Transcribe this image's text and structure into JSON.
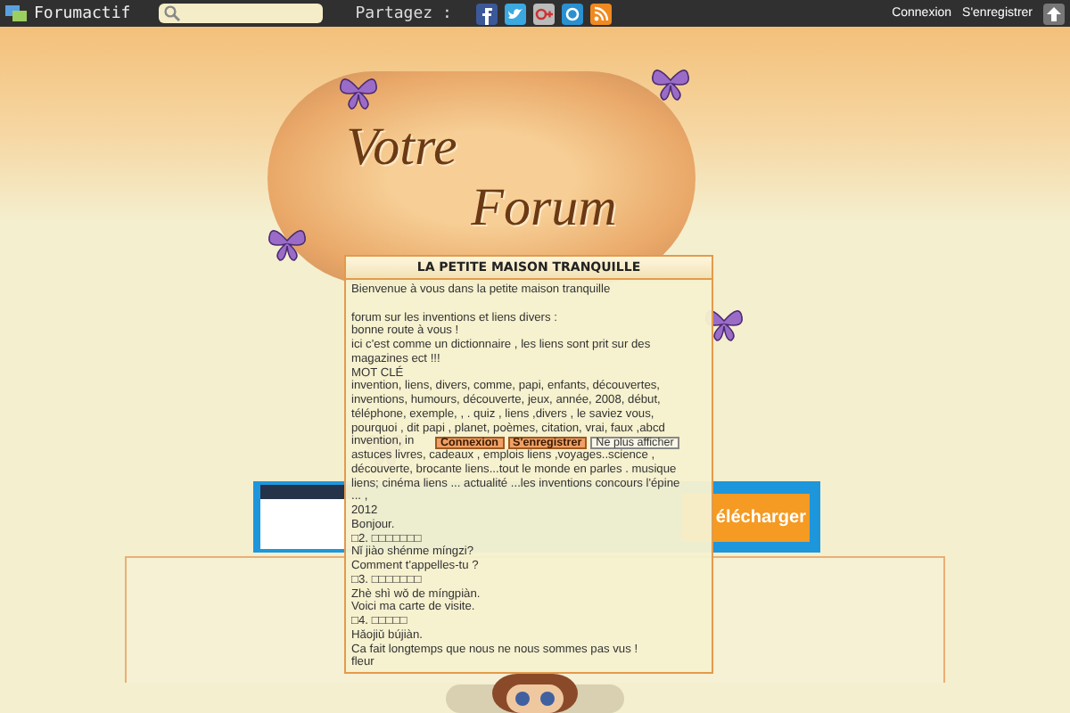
{
  "top_bar": {
    "brand": "Forumactif",
    "share_label": "Partagez :",
    "links": [
      "Connexion",
      "S'enregistrer"
    ]
  },
  "banner": {
    "logo_words": [
      "Votre",
      "Forum"
    ]
  },
  "ad": {
    "button": "élécharger"
  },
  "popup": {
    "title": "LA PETITE MAISON TRANQUILLE",
    "greeting": "Bienvenue à vous dans la petite maison tranquille",
    "lines": [
      "forum sur les inventions et liens divers :",
      "bonne route à vous !",
      "ici c'est comme un dictionnaire , les liens sont prit sur des",
      "magazines ect !!!",
      "MOT CLÉ",
      "invention, liens, divers, comme, papi, enfants, découvertes,",
      "inventions, humours, découverte, jeux, année, 2008, début,",
      "téléphone, exemple, , . quiz , liens ,divers , le saviez vous,",
      "pourquoi , dit papi , planet, poèmes, citation, vrai, faux ,abcd",
      "invention, in",
      "astuces livres, cadeaux , emplois liens ,voyages..science ,",
      "découverte, brocante liens...tout le monde en parles . musique",
      "liens; cinéma liens ... actualité ...les inventions concours l'épine",
      "... ,",
      "2012",
      "Bonjour.",
      "□2. □□□□□□□",
      "Nǐ jiào shénme míngzi?",
      "Comment t'appelles-tu ?",
      "□3. □□□□□□□",
      "Zhè shì wǒ de míngpiàn.",
      "Voici ma carte de visite.",
      "□4. □□□□□",
      "Hǎojiǔ bújiàn.",
      "Ca fait longtemps que nous ne nous sommes pas vus !",
      "fleur"
    ],
    "buttons": [
      {
        "label": "Connexion",
        "kind": "primary"
      },
      {
        "label": "S'enregistrer",
        "kind": "primary"
      },
      {
        "label": "Ne plus afficher",
        "kind": "secondary"
      }
    ]
  }
}
